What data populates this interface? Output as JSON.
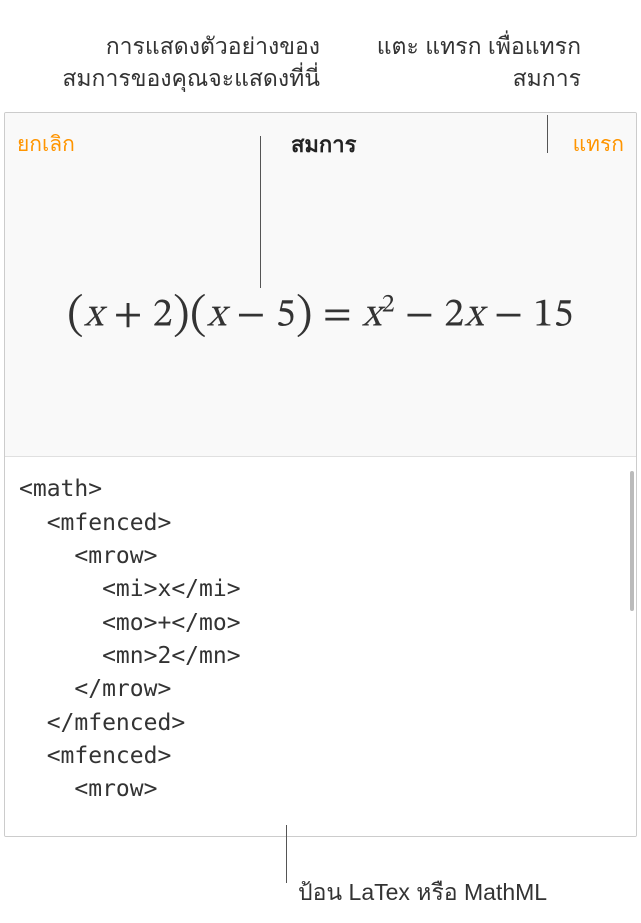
{
  "annotations": {
    "preview": "การแสดงตัวอย่างของสมการของคุณจะแสดงที่นี่",
    "insert": "แตะ แทรก เพื่อแทรกสมการ",
    "input": "ป้อน LaTex หรือ MathML"
  },
  "toolbar": {
    "cancel": "ยกเลิก",
    "title": "สมการ",
    "insert": "แทรก"
  },
  "equation": {
    "display": "(x + 2)(x − 5) = x² − 2x − 15"
  },
  "code": {
    "lines": [
      "<math>",
      "  <mfenced>",
      "    <mrow>",
      "      <mi>x</mi>",
      "      <mo>+</mo>",
      "      <mn>2</mn>",
      "    </mrow>",
      "  </mfenced>",
      "  <mfenced>",
      "    <mrow>"
    ]
  }
}
